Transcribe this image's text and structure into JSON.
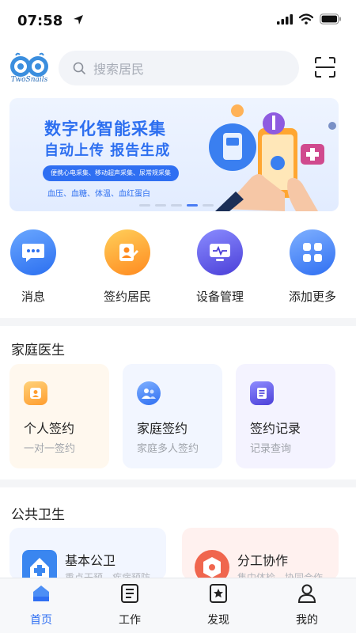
{
  "status": {
    "time": "07:58"
  },
  "brand": {
    "logo_text": "TwoSnails"
  },
  "search": {
    "placeholder": "搜索居民"
  },
  "banner": {
    "title1": "数字化智能采集",
    "title2": "自动上传 报告生成",
    "pill": "便携心电采集、移动超声采集、尿常规采集",
    "subtitle": "血压、血糖、体温、血红蛋白",
    "dots": 5,
    "active_dot": 3
  },
  "quick_actions": [
    {
      "label": "消息",
      "icon": "message-icon"
    },
    {
      "label": "签约居民",
      "icon": "resident-icon"
    },
    {
      "label": "设备管理",
      "icon": "device-icon"
    },
    {
      "label": "添加更多",
      "icon": "apps-icon"
    }
  ],
  "family_doctor": {
    "title": "家庭医生",
    "cards": [
      {
        "title": "个人签约",
        "subtitle": "一对一签约",
        "icon": "person-card-icon"
      },
      {
        "title": "家庭签约",
        "subtitle": "家庭多人签约",
        "icon": "family-icon"
      },
      {
        "title": "签约记录",
        "subtitle": "记录查询",
        "icon": "record-icon"
      }
    ]
  },
  "public_health": {
    "title": "公共卫生",
    "cards": [
      {
        "title": "基本公卫",
        "subtitle": "重点干预、疾病预防",
        "icon": "basic-health-icon"
      },
      {
        "title": "分工协作",
        "subtitle": "集中体检、协同合作",
        "icon": "collaboration-icon"
      }
    ]
  },
  "tabs": [
    {
      "label": "首页",
      "icon": "home-icon",
      "active": true
    },
    {
      "label": "工作",
      "icon": "work-icon",
      "active": false
    },
    {
      "label": "发现",
      "icon": "discover-icon",
      "active": false
    },
    {
      "label": "我的",
      "icon": "profile-icon",
      "active": false
    }
  ],
  "colors": {
    "accent": "#2f6ff2",
    "text": "#222222",
    "muted": "#a0a4ab"
  }
}
